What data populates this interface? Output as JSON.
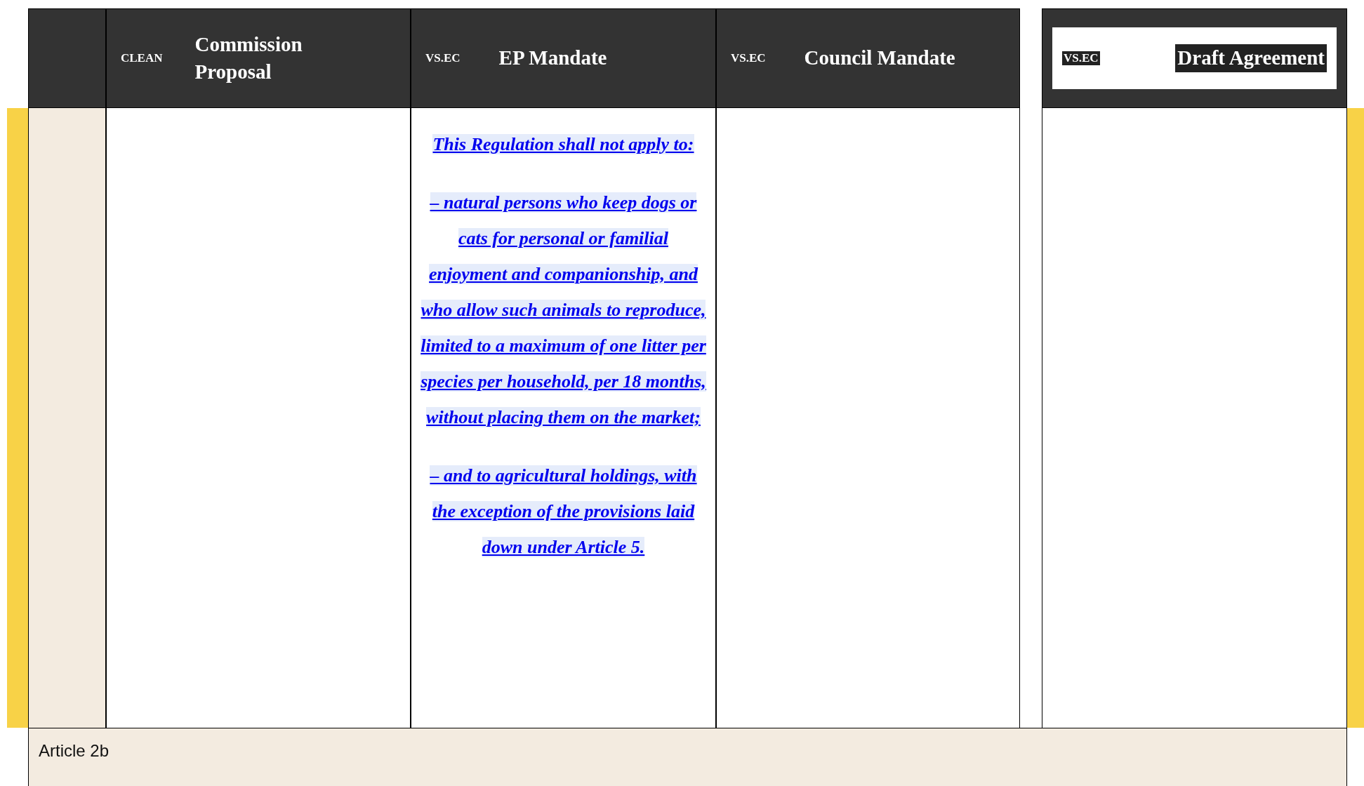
{
  "header": {
    "columns": [
      {
        "tag": "CLEAN",
        "title": "Commission Proposal",
        "kind": "plain"
      },
      {
        "tag": "VS.EC",
        "title": "EP Mandate",
        "kind": "plain"
      },
      {
        "tag": "VS.EC",
        "title": "Council Mandate",
        "kind": "plain"
      },
      {
        "tag": "VS.EC",
        "title": "Draft Agreement",
        "kind": "boxed"
      }
    ]
  },
  "row": {
    "ep_mandate": [
      "This Regulation shall not apply to:",
      "– natural persons who keep dogs or cats for personal or familial enjoyment and companionship, and who allow such animals to reproduce, limited to a maximum of one litter per species per household, per 18 months, without placing them on the market;",
      "– and to agricultural holdings, with the exception of the provisions laid down under Article 5."
    ]
  },
  "footer": {
    "heading": "Article 2b"
  }
}
